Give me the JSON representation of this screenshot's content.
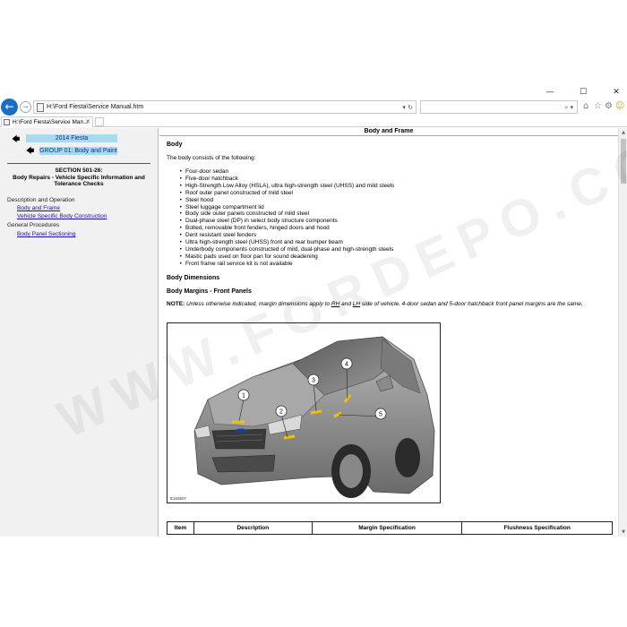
{
  "window_controls": {
    "minimize": "—",
    "maximize": "☐",
    "close": "✕"
  },
  "address_bar": {
    "back_icon": "arrow-left",
    "forward_icon": "arrow-right",
    "url": "H:\\Ford Fiesta\\Service Manual.htm",
    "controls": "▾ ↻",
    "search_icon": "⌕ ▾"
  },
  "toolbar_icons": {
    "home": "⌂",
    "favorites": "☆",
    "settings": "⚙",
    "feedback": "☺"
  },
  "tab": {
    "label": "H:\\Ford Fiesta\\Service Man...",
    "close": "✕"
  },
  "sidebar": {
    "arrow": "🡄",
    "model": "2014 Fiesta",
    "group": "GROUP 01: Body and Paint",
    "section_title": "SECTION 501-26:\nBody Repairs - Vehicle Specific Information and Tolerance Checks",
    "headings": [
      "Description and Operation",
      "General Procedures"
    ],
    "links": [
      "Body and Frame",
      "Vehicle Specific Body Construction",
      "Body Panel Sectioning"
    ]
  },
  "document": {
    "header": "Body and Frame",
    "h_body": "Body",
    "intro": "The body consists of the following:",
    "bullets": [
      "Four-door sedan",
      "Five-door hatchback",
      "High-Strength Low Alloy (HSLA), ultra high-strength steel (UHSS) and mild steels",
      "Roof outer panel constructed of mild steel",
      "Steel hood",
      "Steel luggage compartment lid",
      "Body side outer panels constructed of mild steel",
      "Dual-phase steel (DP) in select body structure components",
      "Bolted, removable front fenders, hinged doors and hood",
      "Dent resistant steel fenders",
      "Ultra high-strength steel (UHSS) front and rear bumper beam",
      "Underbody components constructed of mild, dual-phase and high-strength steels",
      "Mastic pads used on floor pan for sound deadening",
      "Front frame rail service kit is not available"
    ],
    "h_dimensions": "Body Dimensions",
    "h_margins": "Body Margins - Front Panels",
    "note_label": "NOTE:",
    "note_part1": " Unless otherwise indicated, margin dimensions apply to ",
    "note_rh": "RH",
    "note_part2": " and ",
    "note_lh": "LH",
    "note_part3": " side of vehicle. 4-door sedan and 5-door hatchback front panel margins are the same.",
    "figure_code": "E163607",
    "callouts": [
      "1",
      "2",
      "3",
      "4",
      "5"
    ]
  },
  "table": {
    "headers": [
      "Item",
      "Description",
      "Margin Specification",
      "Flushness Specification"
    ]
  },
  "watermark": "WWW.FORDEPO.COM",
  "colors": {
    "accent": "#1a6fc4",
    "sidebar_band": "#a9d9ee",
    "link": "#1a0dab",
    "callout_yellow": "#f2c200"
  }
}
